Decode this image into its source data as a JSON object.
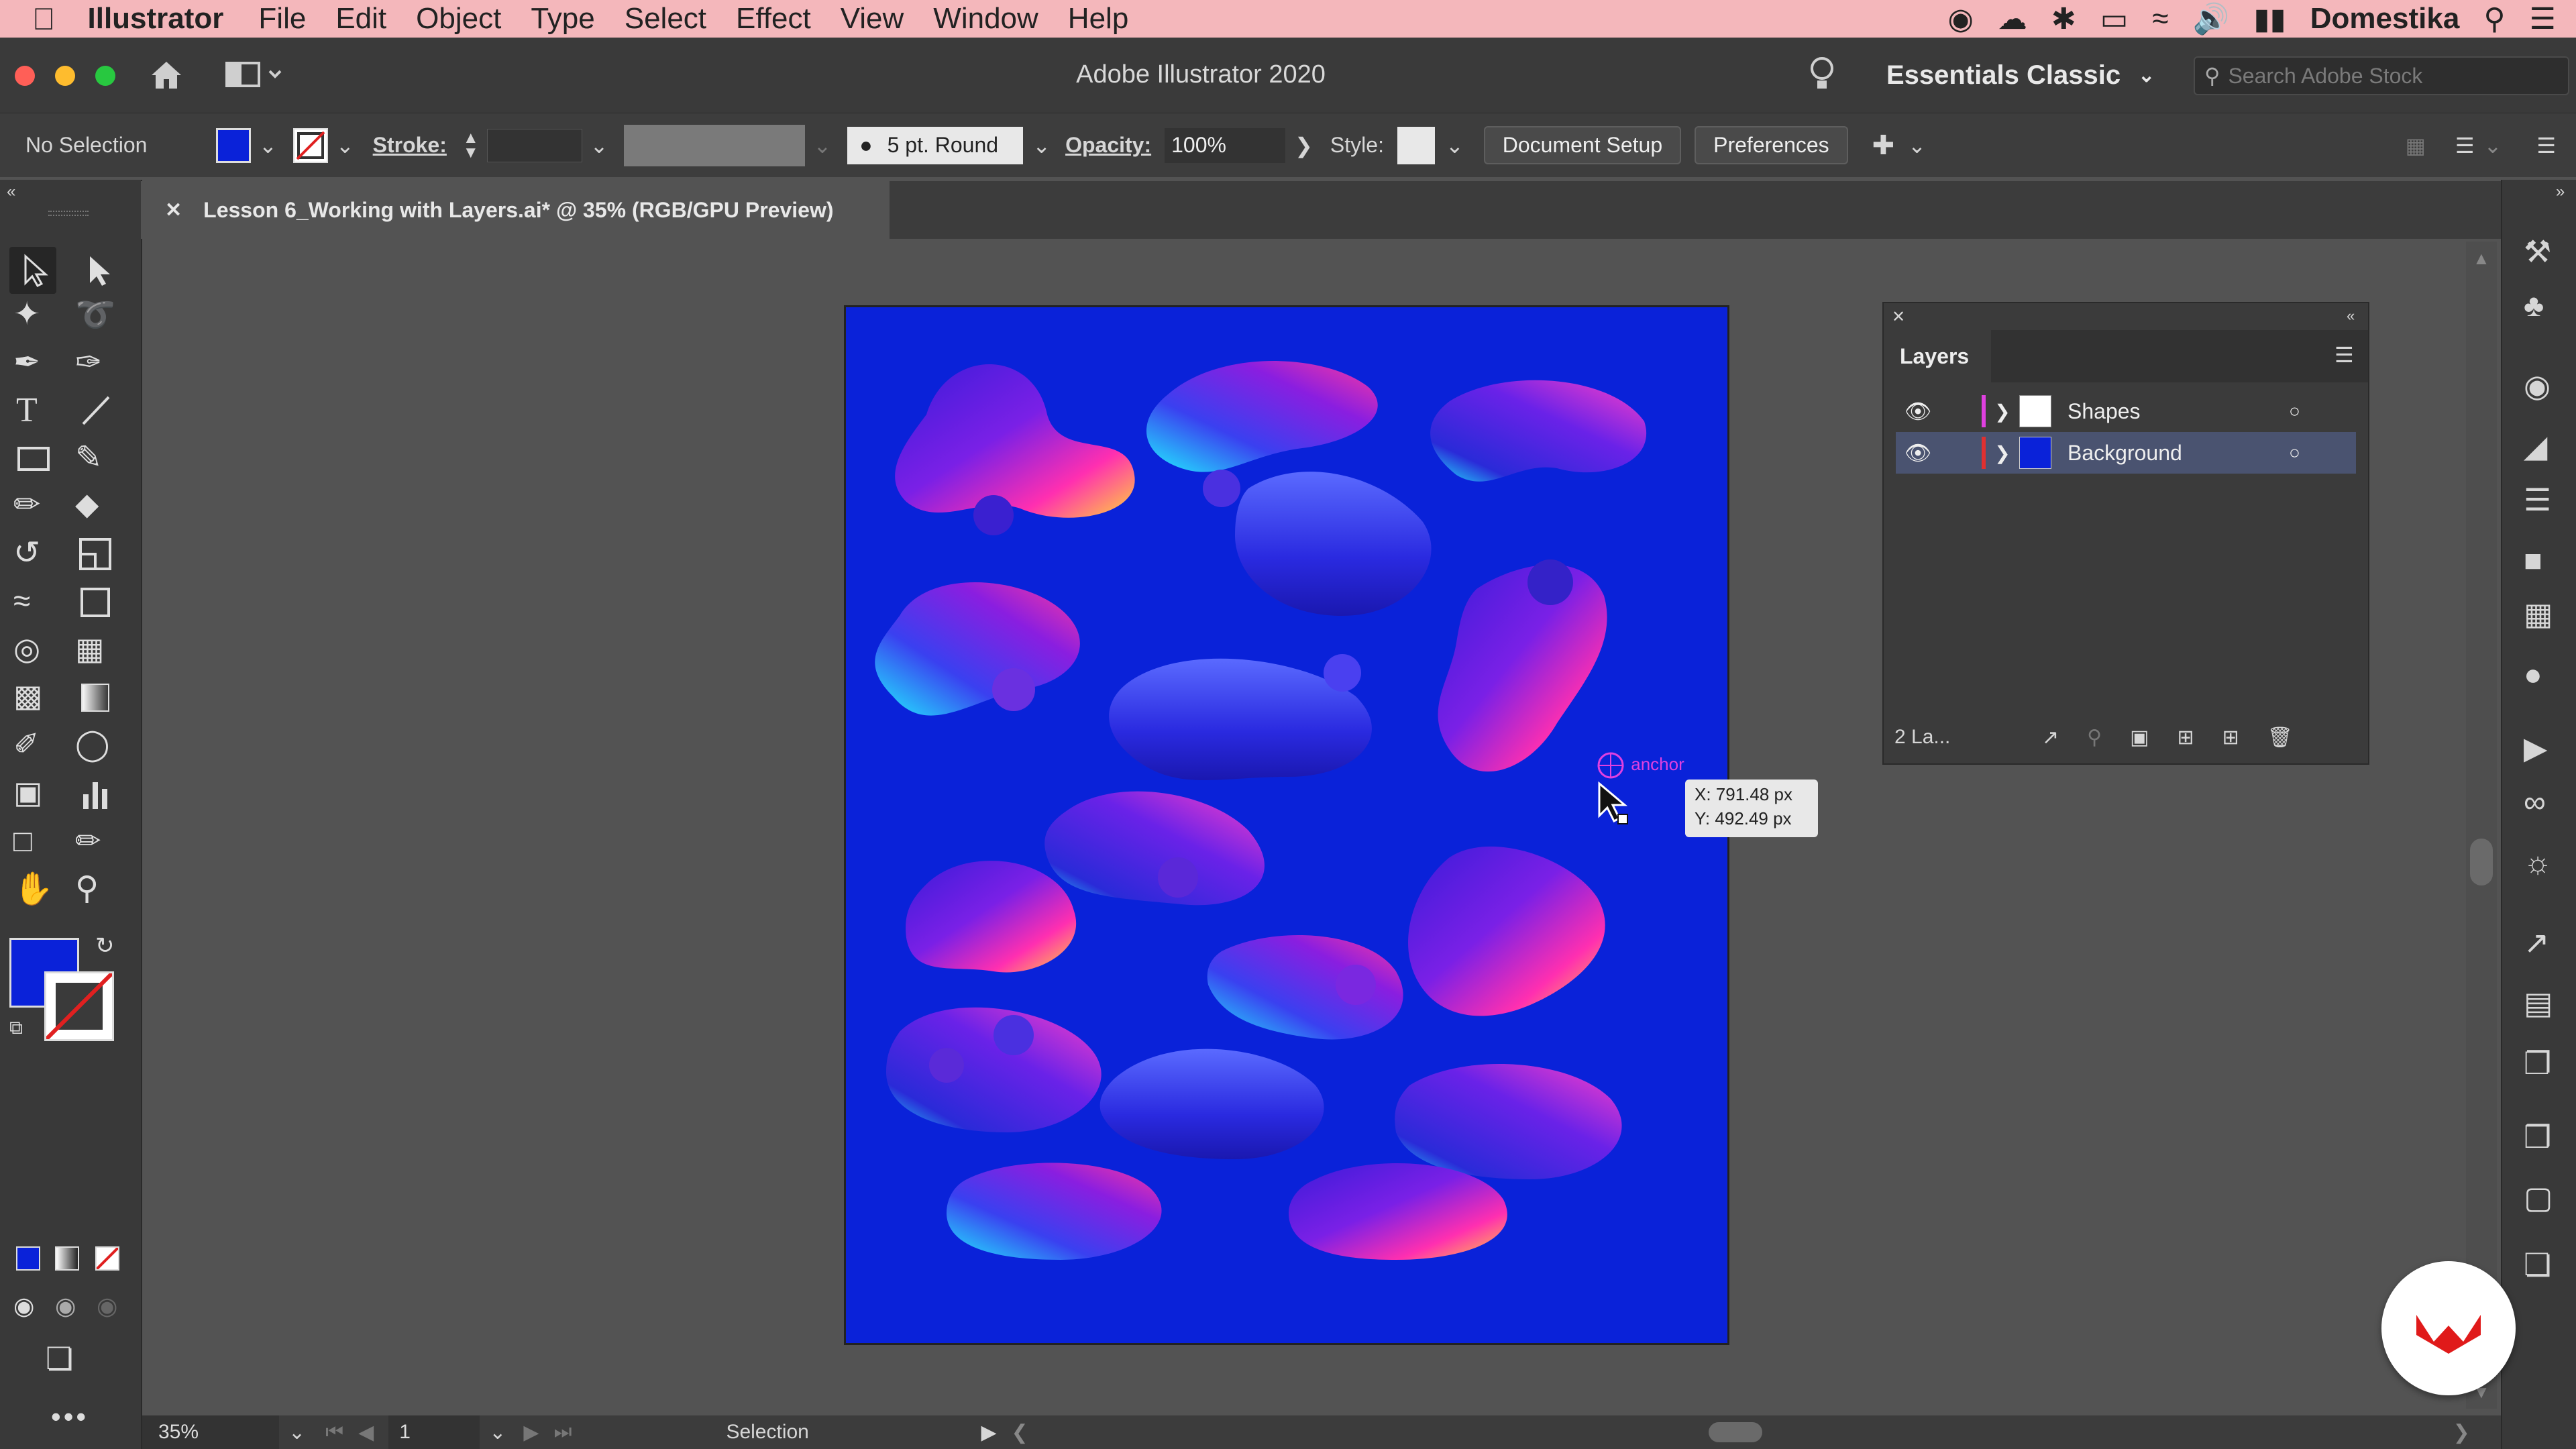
{
  "menubar": {
    "app": "Illustrator",
    "items": [
      "File",
      "Edit",
      "Object",
      "Type",
      "Select",
      "Effect",
      "View",
      "Window",
      "Help"
    ],
    "user": "Domestika"
  },
  "window": {
    "title": "Adobe Illustrator 2020",
    "workspace": "Essentials Classic",
    "search_placeholder": "Search Adobe Stock"
  },
  "control": {
    "selection": "No Selection",
    "stroke_label": "Stroke:",
    "brush": "5 pt. Round",
    "opacity_label": "Opacity:",
    "opacity_value": "100%",
    "style_label": "Style:",
    "doc_setup": "Document Setup",
    "preferences": "Preferences",
    "fill_color": "#0a22d9"
  },
  "document": {
    "tab_title": "Lesson 6_Working with Layers.ai* @ 35% (RGB/GPU Preview)"
  },
  "layers_panel": {
    "title": "Layers",
    "layers": [
      {
        "name": "Shapes",
        "color": "#e040e0"
      },
      {
        "name": "Background",
        "color": "#e03030"
      }
    ],
    "count": "2 La..."
  },
  "cursor": {
    "hint": "anchor",
    "x": "X: 791.48 px",
    "y": "Y: 492.49 px"
  },
  "status": {
    "zoom": "35%",
    "page": "1",
    "tool": "Selection"
  }
}
